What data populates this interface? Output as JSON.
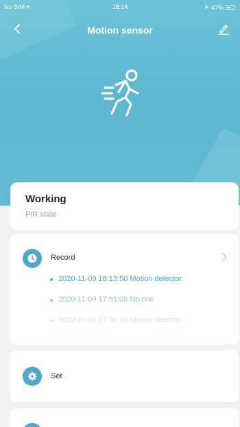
{
  "status_bar": {
    "carrier": "No SIM",
    "time": "18:14",
    "battery": "47%"
  },
  "header": {
    "title": "Motion sensor"
  },
  "icons": {
    "back": "back-arrow-icon",
    "edit": "edit-icon",
    "hero": "running-person-icon",
    "record": "clock-icon",
    "set": "gear-icon"
  },
  "status_card": {
    "title": "Working",
    "subtitle": "PIR state"
  },
  "record_card": {
    "title": "Record",
    "items": [
      "2020-11-09 18:13:50 Motion detector",
      "2020-11-09 17:51:08 No one",
      "2020-11-09 17:50:36 Motion detector"
    ]
  },
  "set_card": {
    "label": "Set"
  },
  "colors": {
    "hero": "#5db8d2",
    "accent": "#4ea8cc",
    "record_text": "#3fa7d4"
  }
}
